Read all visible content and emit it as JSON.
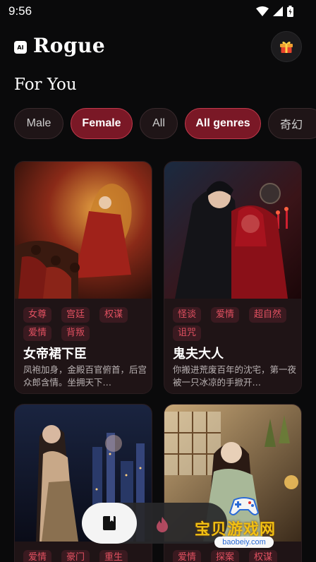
{
  "status_bar": {
    "time": "9:56"
  },
  "header": {
    "logo_badge": "AI",
    "app_title": "Rogue"
  },
  "section_title": "For You",
  "filters": {
    "chips": [
      {
        "label": "Male",
        "active": false
      },
      {
        "label": "Female",
        "active": true
      },
      {
        "label": "All",
        "active": false
      },
      {
        "label": "All genres",
        "active": true
      },
      {
        "label": "奇幻",
        "active": false
      }
    ]
  },
  "stories": [
    {
      "tags": [
        "女尊",
        "宫廷",
        "权谋",
        "爱情",
        "背叛"
      ],
      "title": "女帝裙下臣",
      "description": "凤袍加身，金殿百官俯首，后宫众郎含情。坐拥天下…"
    },
    {
      "tags": [
        "怪谈",
        "爱情",
        "超自然",
        "诅咒"
      ],
      "title": "鬼夫大人",
      "description": "你搬进荒废百年的沈宅，第一夜被一只冰凉的手掀开…"
    },
    {
      "tags": [
        "爱情",
        "豪门",
        "重生"
      ],
      "title": "",
      "description": ""
    },
    {
      "tags": [
        "爱情",
        "探案",
        "权谋"
      ],
      "title": "",
      "description": ""
    }
  ],
  "watermark": {
    "text": "宝贝游戏网",
    "url": "baobeiy.com"
  },
  "colors": {
    "accent": "#7a1826",
    "tag_text": "#e05060",
    "tag_bg": "#3a1a20",
    "card_bg": "#1f1416"
  }
}
